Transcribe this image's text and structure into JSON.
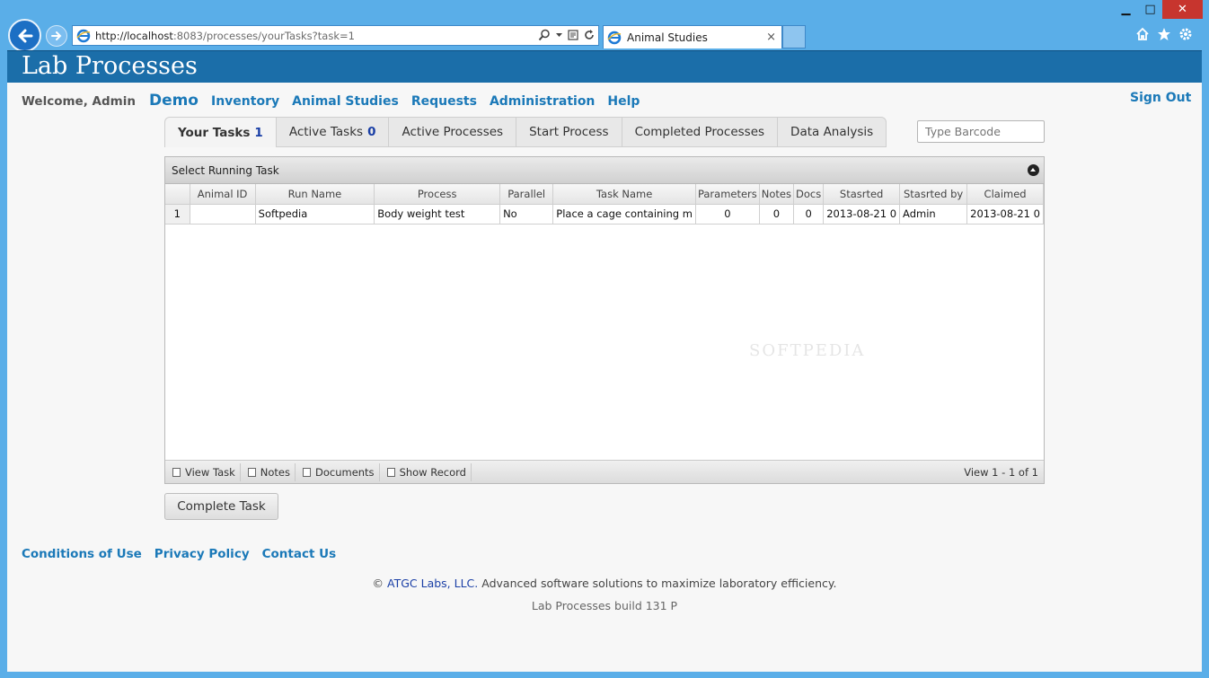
{
  "browser": {
    "url_host": "http://localhost",
    "url_rest": ":8083/processes/yourTasks?task=1",
    "tab_title": "Animal Studies",
    "close_glyph": "×",
    "window_controls": {
      "minimize": "▁",
      "maximize": "□",
      "close": "✕"
    }
  },
  "app": {
    "title": "Lab Processes",
    "welcome": "Welcome, Admin",
    "nav": {
      "demo": "Demo",
      "inventory": "Inventory",
      "animal_studies": "Animal Studies",
      "requests": "Requests",
      "administration": "Administration",
      "help": "Help"
    },
    "sign_out": "Sign Out"
  },
  "tabs": [
    {
      "label": "Your Tasks",
      "count": "1"
    },
    {
      "label": "Active Tasks",
      "count": "0"
    },
    {
      "label": "Active Processes",
      "count": ""
    },
    {
      "label": "Start Process",
      "count": ""
    },
    {
      "label": "Completed Processes",
      "count": ""
    },
    {
      "label": "Data Analysis",
      "count": ""
    }
  ],
  "barcode_placeholder": "Type Barcode",
  "grid": {
    "caption": "Select Running Task",
    "columns": [
      "",
      "Animal ID",
      "Run Name",
      "Process",
      "Parallel",
      "Task Name",
      "Parameters",
      "Notes",
      "Docs",
      "Stasrted",
      "Stasrted by",
      "Claimed"
    ],
    "rows": [
      [
        "1",
        "",
        "Softpedia",
        "Body weight test",
        "No",
        "Place a cage containing m",
        "0",
        "0",
        "0",
        "2013-08-21 0",
        "Admin",
        "2013-08-21 0"
      ]
    ],
    "pager": {
      "view_task": "View Task",
      "notes": "Notes",
      "documents": "Documents",
      "show_record": "Show Record",
      "count": "View 1 - 1 of 1"
    }
  },
  "complete_button": "Complete Task",
  "footer": {
    "links": [
      "Conditions of Use",
      "Privacy Policy",
      "Contact Us"
    ],
    "copyright_prefix": "©",
    "company": "ATGC Labs, LLC.",
    "tagline": "Advanced software solutions to maximize laboratory efficiency.",
    "build": "Lab Processes build 131 P"
  },
  "watermark": "SOFTPEDIA",
  "colors": {
    "banner": "#1b6ea9",
    "link": "#1b79b8",
    "chrome": "#5aaee8",
    "close": "#c7352e"
  }
}
